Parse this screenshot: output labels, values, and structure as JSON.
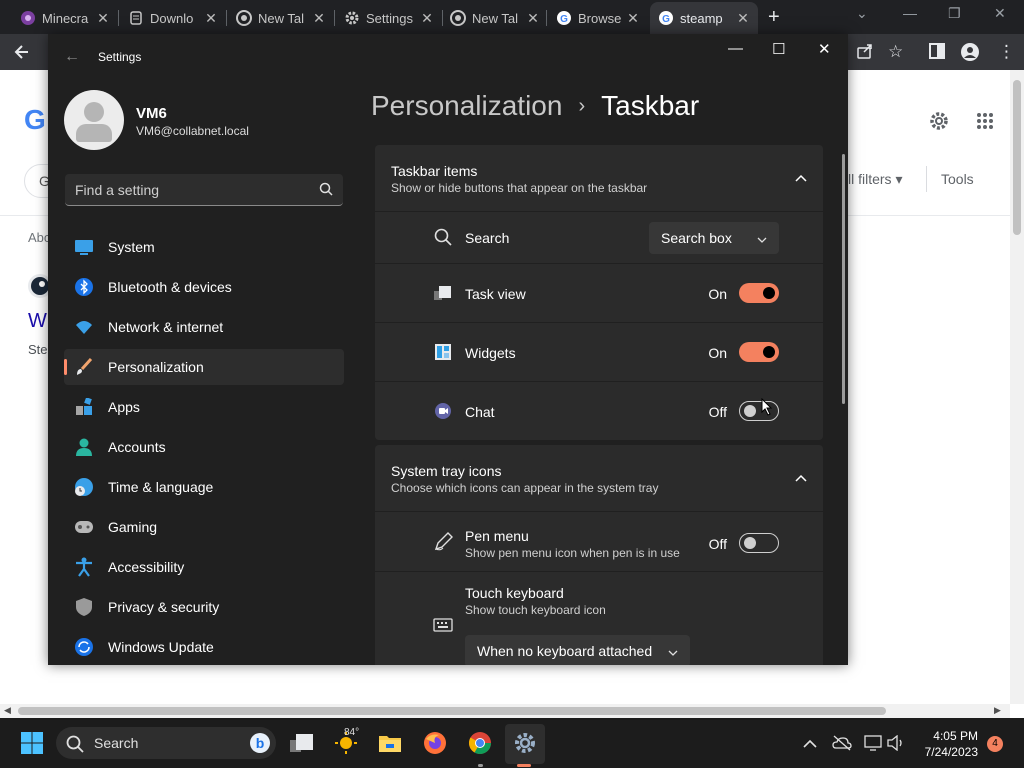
{
  "browser": {
    "tabs": [
      {
        "label": "Minecra",
        "icon": "minecraft-icon"
      },
      {
        "label": "Downlo",
        "icon": "download-icon"
      },
      {
        "label": "New Tal",
        "icon": "chrome-icon"
      },
      {
        "label": "Settings",
        "icon": "gear-icon"
      },
      {
        "label": "New Tal",
        "icon": "chrome-icon"
      },
      {
        "label": "Browse",
        "icon": "google-icon"
      },
      {
        "label": "steamp",
        "icon": "google-icon"
      }
    ],
    "page_fragments": {
      "g_logo": "G",
      "search_g": "G",
      "filters": "ll filters",
      "tools": "Tools",
      "about": "Abo",
      "result_title": "W",
      "result_sub": "Ste"
    }
  },
  "settings": {
    "title": "Settings",
    "user": {
      "name": "VM6",
      "email": "VM6@collabnet.local"
    },
    "search": {
      "placeholder": "Find a setting"
    },
    "nav": [
      {
        "label": "System",
        "icon": "system-icon"
      },
      {
        "label": "Bluetooth & devices",
        "icon": "bluetooth-icon"
      },
      {
        "label": "Network & internet",
        "icon": "wifi-icon"
      },
      {
        "label": "Personalization",
        "icon": "brush-icon",
        "selected": true
      },
      {
        "label": "Apps",
        "icon": "apps-icon"
      },
      {
        "label": "Accounts",
        "icon": "accounts-icon"
      },
      {
        "label": "Time & language",
        "icon": "time-language-icon"
      },
      {
        "label": "Gaming",
        "icon": "gaming-icon"
      },
      {
        "label": "Accessibility",
        "icon": "accessibility-icon"
      },
      {
        "label": "Privacy & security",
        "icon": "shield-icon"
      },
      {
        "label": "Windows Update",
        "icon": "update-icon"
      }
    ],
    "breadcrumb": {
      "parent": "Personalization",
      "separator": "›",
      "current": "Taskbar"
    },
    "taskbar_items": {
      "title": "Taskbar items",
      "subtitle": "Show or hide buttons that appear on the taskbar",
      "search": {
        "label": "Search",
        "value": "Search box"
      },
      "task_view": {
        "label": "Task view",
        "state": "On"
      },
      "widgets": {
        "label": "Widgets",
        "state": "On"
      },
      "chat": {
        "label": "Chat",
        "state": "Off"
      }
    },
    "system_tray": {
      "title": "System tray icons",
      "subtitle": "Choose which icons can appear in the system tray",
      "pen_menu": {
        "label": "Pen menu",
        "sub": "Show pen menu icon when pen is in use",
        "state": "Off"
      },
      "touch_keyboard": {
        "label": "Touch keyboard",
        "sub": "Show touch keyboard icon",
        "value": "When no keyboard attached"
      }
    }
  },
  "taskbar": {
    "search_label": "Search",
    "weather": "84°",
    "time": "4:05 PM",
    "date": "7/24/2023",
    "notifications": "4"
  },
  "colors": {
    "accent": "#f4815f",
    "settings_bg": "#202020",
    "card_bg": "#2b2b2b"
  }
}
